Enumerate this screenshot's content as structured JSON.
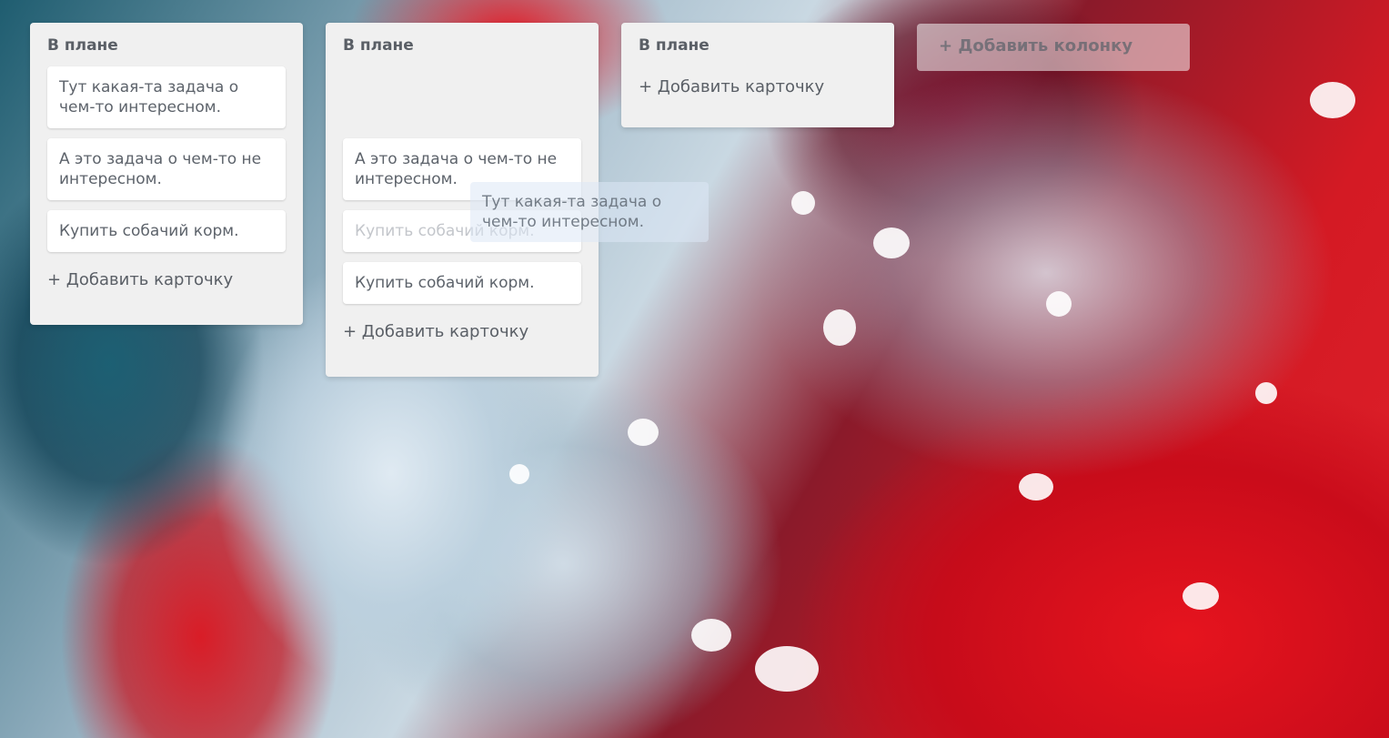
{
  "columns": [
    {
      "title": "В плане",
      "cards": [
        "Тут какая-та задача о чем-то интересном.",
        "А это задача о чем-то не интересном.",
        "Купить собачий корм."
      ],
      "add_card": "+ Добавить карточку"
    },
    {
      "title": "В плане",
      "cards": [
        "А это задача о чем-то не интересном.",
        "Купить собачий корм.",
        "Купить собачий корм."
      ],
      "add_card": "+ Добавить карточку"
    },
    {
      "title": "В плане",
      "cards": [],
      "add_card": "+ Добавить карточку"
    }
  ],
  "dragged_card": "Тут какая-та задача о чем-то интересном.",
  "add_column": "+ Добавить колонку"
}
